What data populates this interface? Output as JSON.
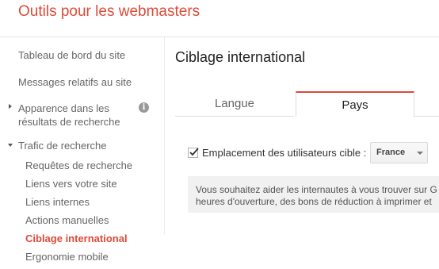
{
  "app": {
    "title": "Outils pour les webmasters"
  },
  "colors": {
    "accent": "#dd4b39",
    "nav_text": "#666666",
    "tab_underline": "#dd4b39",
    "info_box_bg": "#f1f1f1"
  },
  "sidebar": {
    "items": [
      {
        "label": "Tableau de bord du site"
      },
      {
        "label": "Messages relatifs au site"
      },
      {
        "label": "Apparence dans les résultats de recherche",
        "expander": "collapsed",
        "icon": "info-icon"
      },
      {
        "label": "Trafic de recherche",
        "expander": "expanded"
      }
    ],
    "subitems": [
      {
        "label": "Requêtes de recherche"
      },
      {
        "label": "Liens vers votre site"
      },
      {
        "label": "Liens internes"
      },
      {
        "label": "Actions manuelles"
      },
      {
        "label": "Ciblage international",
        "active": true
      },
      {
        "label": "Ergonomie mobile"
      }
    ],
    "info_icon_glyph": "i"
  },
  "main": {
    "page_title": "Ciblage international",
    "tabs": [
      {
        "label": "Langue",
        "selected": false
      },
      {
        "label": "Pays",
        "selected": true
      }
    ],
    "target": {
      "checked": true,
      "label": "Emplacement des utilisateurs cible :",
      "country": "France"
    },
    "info_text": "Vous souhaitez aider les internautes à vous trouver sur G\nheures d'ouverture, des bons de réduction à imprimer et"
  }
}
